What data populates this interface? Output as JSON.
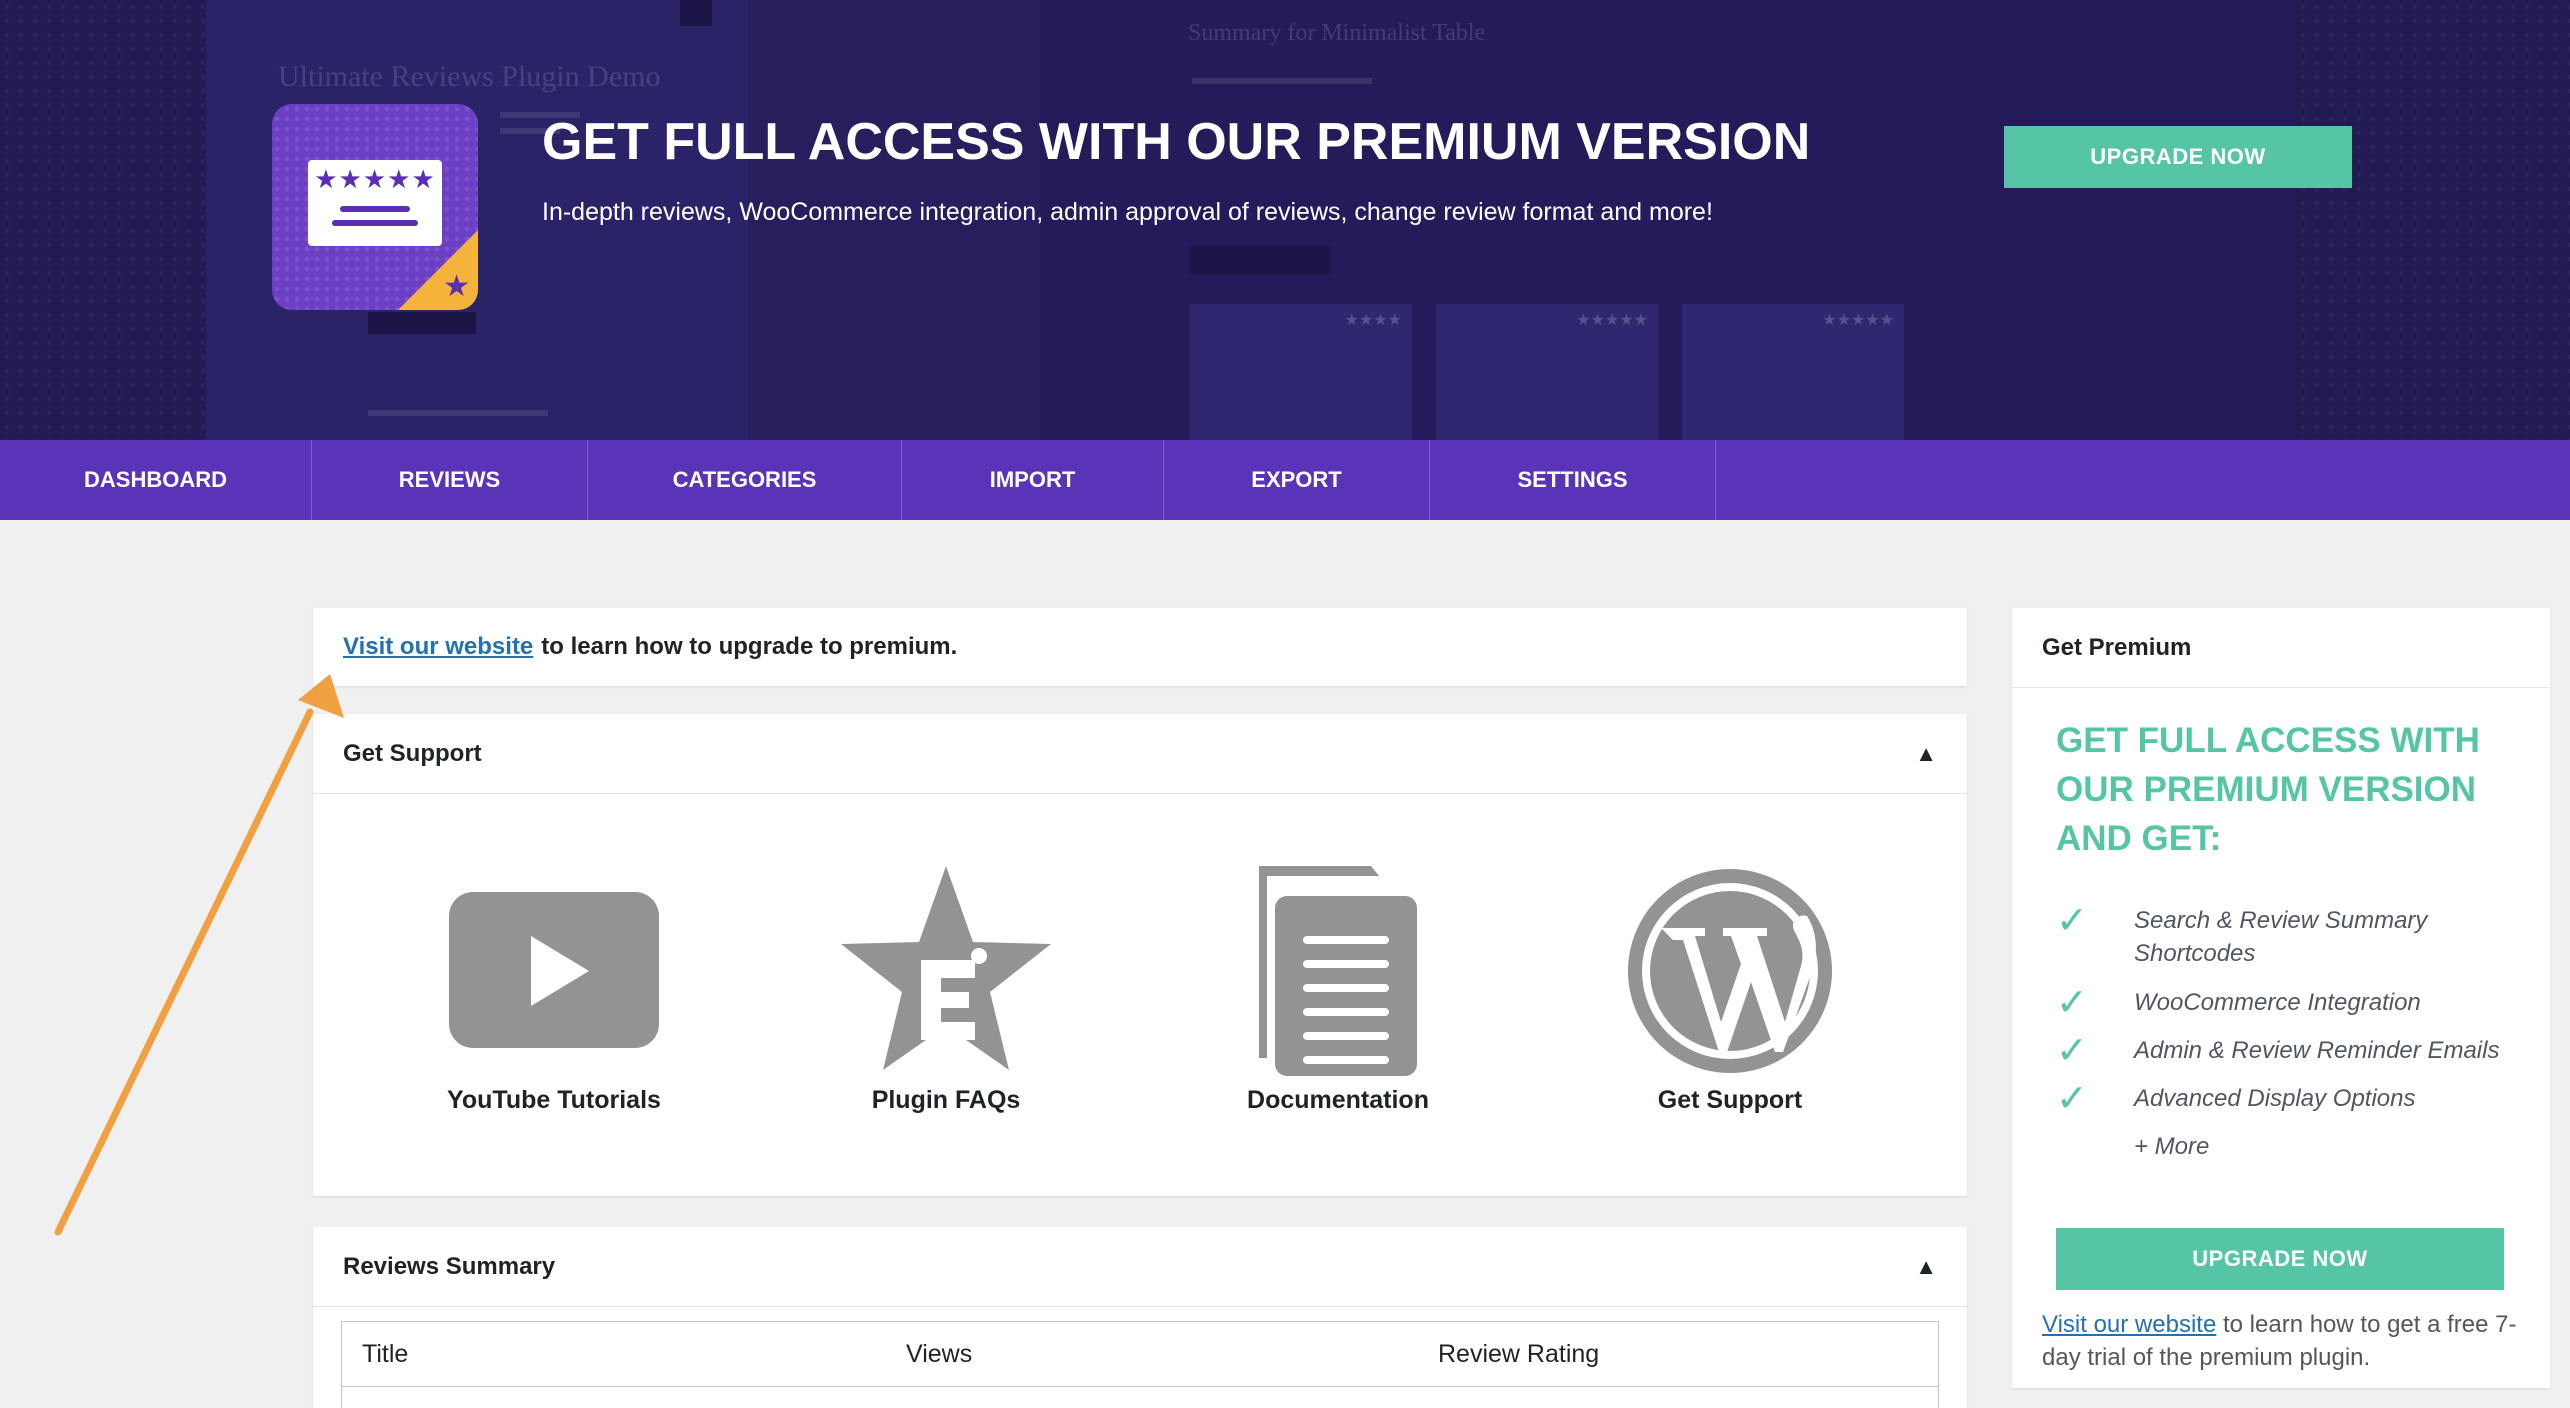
{
  "hero": {
    "title": "GET FULL ACCESS WITH OUR PREMIUM VERSION",
    "subtitle": "In-depth reviews, WooCommerce integration, admin approval of reviews, change review format and more!",
    "upgrade_button": "UPGRADE NOW",
    "background_demo": {
      "left_title": "Ultimate Reviews Plugin Demo",
      "right_title": "Summary for Minimalist Table"
    }
  },
  "nav": {
    "items": [
      {
        "label": "DASHBOARD"
      },
      {
        "label": "REVIEWS"
      },
      {
        "label": "CATEGORIES"
      },
      {
        "label": "IMPORT"
      },
      {
        "label": "EXPORT"
      },
      {
        "label": "SETTINGS"
      }
    ]
  },
  "notice": {
    "link_text": "Visit our website",
    "text": "to learn how to upgrade to premium."
  },
  "support": {
    "title": "Get Support",
    "toggle_icon": "▲",
    "items": [
      {
        "label": "YouTube Tutorials",
        "icon": "youtube-icon"
      },
      {
        "label": "Plugin FAQs",
        "icon": "faq-star-icon"
      },
      {
        "label": "Documentation",
        "icon": "documentation-icon"
      },
      {
        "label": "Get Support",
        "icon": "wordpress-icon"
      }
    ]
  },
  "reviews_summary": {
    "title": "Reviews Summary",
    "toggle_icon": "▲",
    "columns": [
      "Title",
      "Views",
      "Review Rating"
    ]
  },
  "premium": {
    "title": "Get Premium",
    "heading": "GET FULL ACCESS WITH OUR PREMIUM VERSION AND GET:",
    "features": [
      "Search & Review Summary Shortcodes",
      "WooCommerce Integration",
      "Admin & Review Reminder Emails",
      "Advanced Display Options"
    ],
    "more": "+ More",
    "upgrade_button": "UPGRADE NOW",
    "note_link": "Visit our website",
    "note_text": "to learn how to get a free 7-day trial of the premium plugin."
  },
  "colors": {
    "hero_bg": "#221a52",
    "nav_bg": "#5a34b8",
    "accent_green": "#55c5a5",
    "link_blue": "#2271b1",
    "annotation_orange": "#f0a040"
  }
}
